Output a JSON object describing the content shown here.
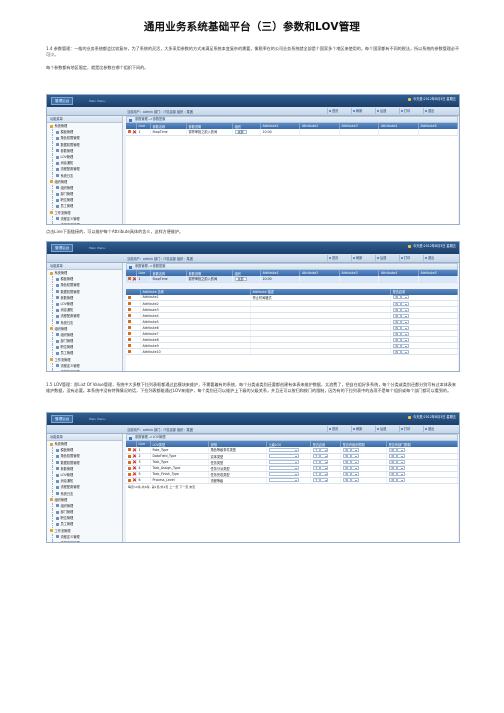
{
  "title": "通用业务系统基础平台（三）参数和LOV管理",
  "p1": "1.4 参数管理：一般的业务系统都会比较复杂，为了系统的灵活，大多采用参数的方式来满足系统本变复杂的需要，像税率在的公司业务系统就全部是个国家多个地区来使用的，每个国家都有不同的税法，所以系统的参数管理必不可少。",
  "p2": "每个参数都有地区限定，就是比参数在哪个组织下间的。",
  "p3": "点击Line下面链接的，可以维护每个Attribute具体的含义，这样方便维护。",
  "p4": "1.5 LOV管理：即List Of Value管理，系统中大多数下拉列表框都通过此模块来维护，不需要着有的系统，每个分类或类别还要都创建有体表来维护数据，太浪费了，把自在组好多系统，每个分类或类别还都分别写有过本体表来维护数据，没有必要。本系统中没有特殊情况的话，下拉列表都能通过LOV来维护，每个类别还可以维护上下级的父级关系，并且还可以按归和按门的限制，因为有的下拉列表中的选项不是每个组织或每个部门都可以看到的。",
  "shot": {
    "logo": "管理后台",
    "logo_sub": "Main Menu",
    "date": "今天是:2012年8月3日 星期五",
    "path": "当前用户：admin 部门：IT信息部 组织：集团",
    "btn_home": "首页",
    "btn_refresh": "刷新",
    "btn_back": "后退",
    "btn_print": "打印",
    "btn_exit": "退出",
    "nav_head": "功能菜单",
    "tree": [
      {
        "t": "g",
        "label": "系统管理"
      },
      {
        "t": "c",
        "label": "模板管理"
      },
      {
        "t": "c",
        "label": "角色权限管理"
      },
      {
        "t": "c",
        "label": "数据权限管理"
      },
      {
        "t": "c",
        "label": "参数管理"
      },
      {
        "t": "c",
        "label": "LOV管理"
      },
      {
        "t": "c",
        "label": "消息通知"
      },
      {
        "t": "c",
        "label": "流程配置管理"
      },
      {
        "t": "c",
        "label": "系统日志"
      },
      {
        "t": "g",
        "label": "组织管理"
      },
      {
        "t": "c",
        "label": "组织管理"
      },
      {
        "t": "c",
        "label": "部门管理"
      },
      {
        "t": "c",
        "label": "职位管理"
      },
      {
        "t": "c",
        "label": "员工管理"
      },
      {
        "t": "g",
        "label": "工作流管理"
      },
      {
        "t": "c",
        "label": "流程定义管理"
      },
      {
        "t": "c",
        "label": "流程实例管理"
      },
      {
        "t": "c",
        "label": "流程监控管理"
      },
      {
        "t": "g",
        "label": "个人设置"
      },
      {
        "t": "c",
        "label": "修改密码"
      },
      {
        "t": "c",
        "label": "切换组织"
      }
    ]
  },
  "screen1": {
    "panel": "参数管理-->参数配置",
    "headers": [
      "",
      "Line",
      "参数名称",
      "参数说明",
      "组织",
      "Attribute1",
      "Attribute2",
      "Attribute3",
      "Attribute4",
      "Attribute5"
    ],
    "row": {
      "line": "1",
      "name": "StopTime",
      "desc": "暂停审批之前入的间",
      "org": "总部",
      "a1": "10:00"
    }
  },
  "screen2": {
    "panel": "参数管理-->参数配置",
    "headers": [
      "",
      "Line",
      "参数名称",
      "参数说明",
      "组织",
      "Attribute1",
      "Attribute2",
      "Attribute3",
      "Attribute4",
      "Attribute5"
    ],
    "row": {
      "line": "1",
      "name": "StopTime",
      "desc": "暂停审批之前入的间",
      "org": "总部",
      "a1": "10:00"
    },
    "sub_headers": [
      "",
      "Attribute 名称",
      "Attribute 描述",
      "是否启用"
    ],
    "attrs": [
      {
        "n": "Attribute1",
        "d": "停止时间格式",
        "e": "N"
      },
      {
        "n": "Attribute2",
        "d": "",
        "e": "N"
      },
      {
        "n": "Attribute3",
        "d": "",
        "e": "N"
      },
      {
        "n": "Attribute4",
        "d": "",
        "e": "N"
      },
      {
        "n": "Attribute5",
        "d": "",
        "e": "N"
      },
      {
        "n": "Attribute6",
        "d": "",
        "e": "N"
      },
      {
        "n": "Attribute7",
        "d": "",
        "e": "N"
      },
      {
        "n": "Attribute8",
        "d": "",
        "e": "N"
      },
      {
        "n": "Attribute9",
        "d": "",
        "e": "N"
      },
      {
        "n": "Attribute10",
        "d": "",
        "e": "N"
      }
    ]
  },
  "screen3": {
    "panel": "参数管理-->LOV管理",
    "headers": [
      "",
      "Line",
      "LOV类型",
      "说明",
      "上级LOV",
      "是否启用",
      "是否有组织限制",
      "是否有部门限制"
    ],
    "rows": [
      {
        "line": "1",
        "type": "Role_Type",
        "desc": "角色等级事件类型"
      },
      {
        "line": "2",
        "type": "DataField_Type",
        "desc": "实体类型"
      },
      {
        "line": "3",
        "type": "Task_Type",
        "desc": "任务类型"
      },
      {
        "line": "4",
        "type": "Task_Assign_Type",
        "desc": "任务分派类型"
      },
      {
        "line": "5",
        "type": "Task_Finish_Type",
        "desc": "任务完成类型"
      },
      {
        "line": "6",
        "type": "Process_Level",
        "desc": "流程等级"
      }
    ],
    "flag_y": "Y",
    "flag_n": "N",
    "pager": "每页10条,共6条, 第1页/共1页 上一页 下一页 末页"
  }
}
